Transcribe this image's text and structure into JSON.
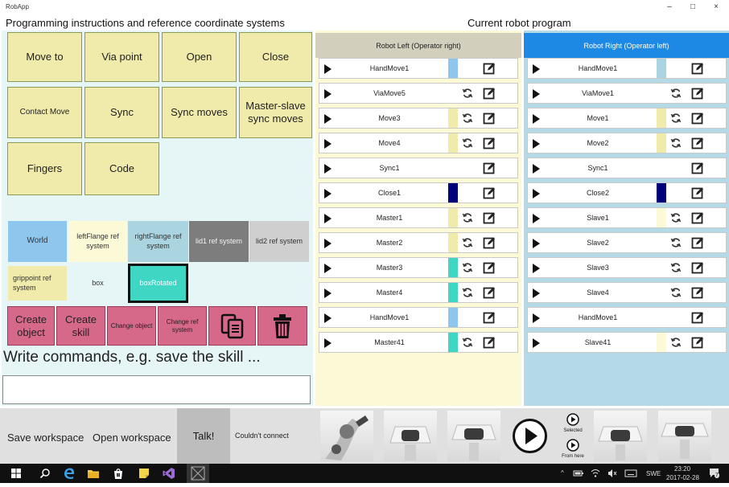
{
  "window": {
    "title": "RobApp",
    "minimize": "–",
    "maximize": "□",
    "close": "×"
  },
  "headings": {
    "left": "Programming instructions and reference coordinate systems",
    "right": "Current robot program"
  },
  "instructions": [
    {
      "label": "Move to"
    },
    {
      "label": "Via point"
    },
    {
      "label": "Open"
    },
    {
      "label": "Close"
    },
    {
      "label": "Contact Move"
    },
    {
      "label": "Sync"
    },
    {
      "label": "Sync moves"
    },
    {
      "label": "Master-slave sync moves"
    },
    {
      "label": "Fingers"
    },
    {
      "label": "Code"
    }
  ],
  "ref_systems": [
    {
      "label": "World",
      "color": "#8fc6ee"
    },
    {
      "label": "leftFlange ref system",
      "color": "#fbf9d6"
    },
    {
      "label": "rightFlange ref system",
      "color": "#a9d4e0"
    },
    {
      "label": "lid1 ref system",
      "color": "#7d7d7d"
    },
    {
      "label": "lid2 ref system",
      "color": "#cfcfcf"
    },
    {
      "label": "grippoint ref system",
      "color": "#f0ebaa"
    },
    {
      "label": "box",
      "color": "#e6f6f7"
    },
    {
      "label": "boxRotated",
      "color": "#3fd6c4"
    }
  ],
  "object_buttons": {
    "create_object": "Create object",
    "create_skill": "Create skill",
    "change_object": "Change object",
    "change_ref_system": "Change ref system"
  },
  "command": {
    "label": "Write commands, e.g. save the skill ...",
    "value": ""
  },
  "program_left": {
    "header": "Robot Left (Operator right)",
    "header_color": "#d2cfbd",
    "rows": [
      {
        "name": "HandMove1",
        "stripe": "#8fc6ee",
        "sync": false
      },
      {
        "name": "ViaMove5",
        "stripe": "#ffffff",
        "sync": true
      },
      {
        "name": "Move3",
        "stripe": "#f0ebaa",
        "sync": true
      },
      {
        "name": "Move4",
        "stripe": "#f0ebaa",
        "sync": true
      },
      {
        "name": "Sync1",
        "stripe": "#ffffff",
        "sync": false
      },
      {
        "name": "Close1",
        "stripe": "#00007a",
        "sync": false
      },
      {
        "name": "Master1",
        "stripe": "#f0ebaa",
        "sync": true
      },
      {
        "name": "Master2",
        "stripe": "#f0ebaa",
        "sync": true
      },
      {
        "name": "Master3",
        "stripe": "#3fd6c4",
        "sync": true
      },
      {
        "name": "Master4",
        "stripe": "#3fd6c4",
        "sync": true
      },
      {
        "name": "HandMove1",
        "stripe": "#8fc6ee",
        "sync": false
      },
      {
        "name": "Master41",
        "stripe": "#3fd6c4",
        "sync": true
      }
    ]
  },
  "program_right": {
    "header": "Robot Right (Operator left)",
    "header_color": "#1e88e5",
    "rows": [
      {
        "name": "HandMove1",
        "stripe": "#a9d4e0",
        "sync": false
      },
      {
        "name": "ViaMove1",
        "stripe": "#ffffff",
        "sync": true
      },
      {
        "name": "Move1",
        "stripe": "#f0ebaa",
        "sync": true
      },
      {
        "name": "Move2",
        "stripe": "#f0ebaa",
        "sync": true
      },
      {
        "name": "Sync1",
        "stripe": "#ffffff",
        "sync": false
      },
      {
        "name": "Close2",
        "stripe": "#00007a",
        "sync": false
      },
      {
        "name": "Slave1",
        "stripe": "#fbf9d6",
        "sync": true
      },
      {
        "name": "Slave2",
        "stripe": "#ffffff",
        "sync": true
      },
      {
        "name": "Slave3",
        "stripe": "#ffffff",
        "sync": true
      },
      {
        "name": "Slave4",
        "stripe": "#ffffff",
        "sync": true
      },
      {
        "name": "HandMove1",
        "stripe": "#ffffff",
        "sync": false
      },
      {
        "name": "Slave41",
        "stripe": "#fbf9d6",
        "sync": true
      }
    ]
  },
  "bottom": {
    "save_workspace": "Save workspace",
    "open_workspace": "Open workspace",
    "talk": "Talk!",
    "status": "Couldn't connect",
    "selected": "Selected",
    "from_here": "From here"
  },
  "taskbar": {
    "language": "SWE",
    "time": "23:20",
    "date": "2017-02-28",
    "notifications": "7"
  }
}
